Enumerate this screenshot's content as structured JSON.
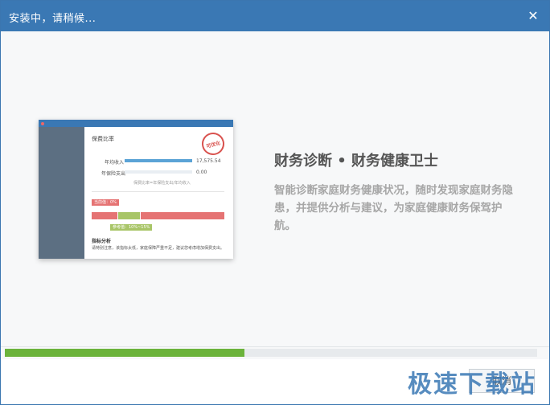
{
  "window": {
    "title": "安装中，请稍候...",
    "close_symbol": "✕"
  },
  "preview": {
    "title": "保费比率",
    "stamp": "可优化",
    "row1_label": "年均收入",
    "row1_value": "17,575.54",
    "row2_label": "年保险支出",
    "row2_value": "0.00",
    "note": "保费比率=年保险支出/年均收入",
    "tag_low": "当前值：0%",
    "tag_range": "参考值：10%~15%",
    "analysis_title": "指标分析",
    "analysis_text": "请特别注意，该指标太低，家庭保障严重不足，建议您考虑增加保费支出。"
  },
  "content": {
    "headline": "财务诊断 • 财务健康卫士",
    "description": "智能诊断家庭财务健康状况，随时发现家庭财务隐患，并提供分析与建议，为家庭健康财务保驾护航。"
  },
  "progress": {
    "fraction": 0.45
  },
  "footer": {
    "cancel_label": "取消",
    "watermark": "极速下载站"
  },
  "colors": {
    "titlebar": "#3a78b4",
    "progress": "#6bb33b",
    "danger": "#e57373",
    "ok": "#a8c567"
  }
}
